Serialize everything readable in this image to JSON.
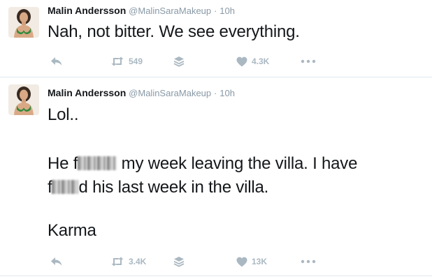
{
  "tweets": [
    {
      "display_name": "Malin Andersson",
      "handle": "@MalinSaraMakeup",
      "separator": "·",
      "time": "10h",
      "text": "Nah, not bitter. We see everything.",
      "retweets": "549",
      "likes": "4.3K",
      "icons": [
        "reply-icon",
        "retweet-icon",
        "layers-icon",
        "heart-icon",
        "more-icon"
      ]
    },
    {
      "display_name": "Malin Andersson",
      "handle": "@MalinSaraMakeup",
      "separator": "·",
      "time": "10h",
      "text_line1": "Lol..",
      "text_line2_a": "He f",
      "text_line2_b": " my week leaving the villa. I have",
      "text_line3_a": "f",
      "text_line3_b": "d his last week in the villa.",
      "text_line4": "Karma",
      "retweets": "3.4K",
      "likes": "13K",
      "icons": [
        "reply-icon",
        "retweet-icon",
        "layers-icon",
        "heart-icon",
        "more-icon"
      ]
    }
  ],
  "colors": {
    "name": "#14171a",
    "meta": "#8899a6",
    "action": "#aab8c2",
    "divider": "#e1e8ed"
  }
}
